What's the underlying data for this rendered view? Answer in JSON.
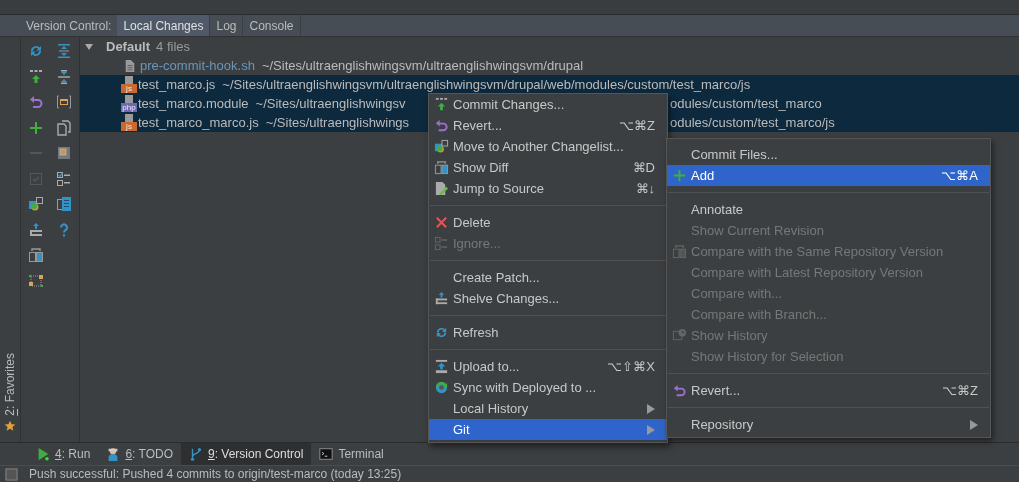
{
  "tool_window": {
    "label": "Version Control:",
    "tabs": [
      {
        "label": "Local Changes",
        "selected": true
      },
      {
        "label": "Log",
        "selected": false
      },
      {
        "label": "Console",
        "selected": false
      }
    ]
  },
  "toolbar": {
    "left": [
      {
        "disabled": false
      },
      {
        "disabled": false
      },
      {
        "disabled": false
      },
      {
        "disabled": false
      },
      {
        "disabled": true
      },
      {
        "disabled": true
      },
      {
        "disabled": false
      },
      {
        "disabled": false
      },
      {
        "disabled": false
      },
      {
        "disabled": false
      }
    ],
    "right": [
      {
        "disabled": false
      },
      {
        "disabled": false
      },
      {
        "disabled": false
      },
      {
        "disabled": false
      },
      {
        "disabled": false
      },
      {
        "disabled": false
      },
      {
        "disabled": false
      },
      {
        "disabled": false
      }
    ]
  },
  "changelist": {
    "name": "Default",
    "count": "4 files",
    "expanded": true,
    "files": [
      {
        "name": "pre-commit-hook.sh",
        "path": "~/Sites/ultraenglishwingsvm/ultraenglishwingsvm/drupal",
        "color": "#6897bb",
        "selected": false
      },
      {
        "name": "test_marco.js",
        "path": "~/Sites/ultraenglishwingsvm/ultraenglishwingsvm/drupal/web/modules/custom/test_marco/js",
        "type": "js",
        "color": "#bbbbbb",
        "selected": true
      },
      {
        "name": "test_marco.module",
        "path": "~/Sites/ultraenglishwingsv",
        "path_tail": "odules/custom/test_marco",
        "type": "php",
        "color": "#bbbbbb",
        "selected": true
      },
      {
        "name": "test_marco_marco.js",
        "path": "~/Sites/ultraenglishwings",
        "path_tail": "odules/custom/test_marco/js",
        "type": "js",
        "color": "#bbbbbb",
        "selected": true
      }
    ]
  },
  "context_menu": [
    {
      "kind": "item",
      "label": "Commit Changes...",
      "disabled": false,
      "selected": false
    },
    {
      "kind": "item",
      "label": "Revert...",
      "shortcut": "⌥⌘Z",
      "disabled": false,
      "selected": false
    },
    {
      "kind": "item",
      "label": "Move to Another Changelist...",
      "disabled": false,
      "selected": false
    },
    {
      "kind": "item",
      "label": "Show Diff",
      "shortcut": "⌘D",
      "disabled": false,
      "selected": false
    },
    {
      "kind": "item",
      "label": "Jump to Source",
      "shortcut": "⌘↓",
      "disabled": false,
      "selected": false
    },
    {
      "kind": "separator"
    },
    {
      "kind": "item",
      "label": "Delete",
      "disabled": false,
      "selected": false
    },
    {
      "kind": "item",
      "label": "Ignore...",
      "disabled": true,
      "selected": false
    },
    {
      "kind": "separator"
    },
    {
      "kind": "item",
      "label": "Create Patch...",
      "disabled": false,
      "selected": false
    },
    {
      "kind": "item",
      "label": "Shelve Changes...",
      "disabled": false,
      "selected": false
    },
    {
      "kind": "separator"
    },
    {
      "kind": "item",
      "label": "Refresh",
      "disabled": false,
      "selected": false
    },
    {
      "kind": "separator"
    },
    {
      "kind": "item",
      "label": "Upload to...",
      "shortcut": "⌥⇧⌘X",
      "disabled": false,
      "selected": false
    },
    {
      "kind": "item",
      "label": "Sync with Deployed to ...",
      "disabled": false,
      "selected": false
    },
    {
      "kind": "submenu",
      "label": "Local History",
      "disabled": false,
      "selected": false
    },
    {
      "kind": "submenu",
      "label": "Git",
      "disabled": false,
      "selected": true
    }
  ],
  "git_submenu": [
    {
      "kind": "item",
      "label": "Commit Files...",
      "disabled": false,
      "selected": false
    },
    {
      "kind": "item",
      "label": "Add",
      "shortcut": "⌥⌘A",
      "disabled": false,
      "selected": true
    },
    {
      "kind": "separator"
    },
    {
      "kind": "item",
      "label": "Annotate",
      "disabled": false,
      "selected": false
    },
    {
      "kind": "item",
      "label": "Show Current Revision",
      "disabled": true,
      "selected": false
    },
    {
      "kind": "item",
      "label": "Compare with the Same Repository Version",
      "disabled": true,
      "selected": false
    },
    {
      "kind": "item",
      "label": "Compare with Latest Repository Version",
      "disabled": true,
      "selected": false
    },
    {
      "kind": "item",
      "label": "Compare with...",
      "disabled": true,
      "selected": false
    },
    {
      "kind": "item",
      "label": "Compare with Branch...",
      "disabled": true,
      "selected": false
    },
    {
      "kind": "item",
      "label": "Show History",
      "disabled": true,
      "selected": false
    },
    {
      "kind": "item",
      "label": "Show History for Selection",
      "disabled": true,
      "selected": false
    },
    {
      "kind": "separator"
    },
    {
      "kind": "item",
      "label": "Revert...",
      "shortcut": "⌥⌘Z",
      "disabled": false,
      "selected": false
    },
    {
      "kind": "separator"
    },
    {
      "kind": "submenu",
      "label": "Repository",
      "disabled": false,
      "selected": false
    }
  ],
  "side_tab": {
    "number": "2",
    "label": ": Favorites"
  },
  "bottom_tabs": [
    {
      "number": "4",
      "label": ": Run",
      "selected": false
    },
    {
      "number": "6",
      "label": ": TODO",
      "selected": false
    },
    {
      "number": "9",
      "label": ": Version Control",
      "selected": true
    },
    {
      "label": "Terminal",
      "selected": false
    }
  ],
  "status_bar": "Push successful: Pushed 4 commits to origin/test-marco (today 13:25)"
}
